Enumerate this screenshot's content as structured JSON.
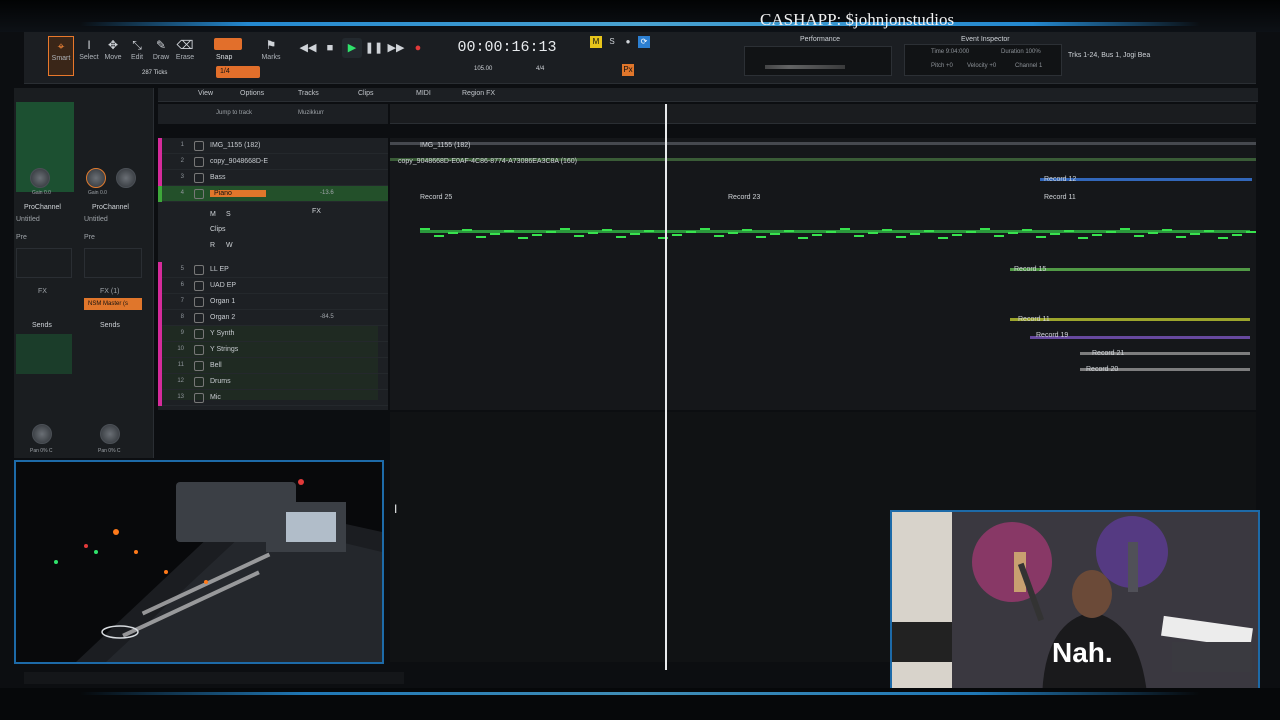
{
  "overlay": {
    "cashapp_text": "CASHAPP: $johnjonstudios"
  },
  "toolbar": {
    "tools": [
      {
        "label": "Smart",
        "icon": "smart-tool-icon",
        "active": true
      },
      {
        "label": "Select",
        "icon": "select-tool-icon",
        "active": false
      },
      {
        "label": "Move",
        "icon": "move-tool-icon",
        "active": false
      },
      {
        "label": "Edit",
        "icon": "edit-tool-icon",
        "active": false
      },
      {
        "label": "Draw",
        "icon": "draw-tool-icon",
        "active": false
      },
      {
        "label": "Erase",
        "icon": "erase-tool-icon",
        "active": false
      }
    ],
    "snap_label": "Snap",
    "snap_value": "1/4",
    "markers_label": "Marks",
    "ticks_label": "287 Ticks"
  },
  "transport": {
    "timecode": "00:00:16:13",
    "tempo": "105.00",
    "meter": "4/4",
    "beat": "4/4"
  },
  "panels": {
    "performance_title": "Performance",
    "event_inspector_title": "Event Inspector",
    "inspector_time": "Time  9:04:000",
    "inspector_duration": "Duration  100%",
    "inspector_pitch": "Pitch  +0",
    "inspector_velocity": "Velocity  +0",
    "inspector_channel": "Channel  1",
    "track_info": "Trks 1-24, Bus 1, Jogi Bea"
  },
  "inspector": {
    "left_strip": {
      "title": "ProChannel",
      "sub": "Untitled",
      "pre": "Pre",
      "fx": "FX",
      "sends": "Sends",
      "pan": "Pan 0% C",
      "gain": "Gain 0.0"
    },
    "right_strip": {
      "title": "ProChannel",
      "sub": "Untitled",
      "pre": "Pre",
      "fx": "FX (1)",
      "bus": "NSM Master (s",
      "sends": "Sends",
      "pan": "Pan 0% C",
      "gain": "Gain 0.0"
    }
  },
  "trackview": {
    "menus": [
      "View",
      "Options",
      "Tracks",
      "Clips",
      "MIDI",
      "Region FX"
    ],
    "jump_to_track": "Jump to track",
    "workspace": "Muzikkurr"
  },
  "tracks": [
    {
      "num": "1",
      "name": "IMG_1155 (182)",
      "color": "#d62b9b",
      "vol": ""
    },
    {
      "num": "2",
      "name": "copy_9048668D-E",
      "color": "#d62b9b",
      "vol": ""
    },
    {
      "num": "3",
      "name": "Bass",
      "color": "#d62b9b",
      "vol": ""
    },
    {
      "num": "4",
      "name": "Piano",
      "color": "#3ea83a",
      "vol": "-13.6"
    },
    {
      "num": "5",
      "name": "LL EP",
      "color": "#d62b9b",
      "vol": ""
    },
    {
      "num": "6",
      "name": "UAD EP",
      "color": "#d62b9b",
      "vol": ""
    },
    {
      "num": "7",
      "name": "Organ 1",
      "color": "#d62b9b",
      "vol": ""
    },
    {
      "num": "8",
      "name": "Organ 2",
      "color": "#d62b9b",
      "vol": "-84.5"
    },
    {
      "num": "9",
      "name": "Y Synth",
      "color": "#d62b9b",
      "vol": ""
    },
    {
      "num": "10",
      "name": "Y Strings",
      "color": "#d62b9b",
      "vol": ""
    },
    {
      "num": "11",
      "name": "Bell",
      "color": "#d62b9b",
      "vol": ""
    },
    {
      "num": "12",
      "name": "Drums",
      "color": "#d62b9b",
      "vol": ""
    },
    {
      "num": "13",
      "name": "Mic",
      "color": "#d62b9b",
      "vol": ""
    }
  ],
  "piano_controls": {
    "m": "M",
    "s": "S",
    "fx": "FX",
    "clips": "Clips",
    "r": "R",
    "w": "W"
  },
  "clips": {
    "row1": "IMG_1155 (182)",
    "row2": "copy_9048668D-E0AF-4C86-8774-A73086EA3C8A (160)",
    "record12": "Record 12",
    "record25": "Record 25",
    "record23": "Record 23",
    "record11": "Record 11",
    "record15": "Record 15",
    "record11b": "Record 11",
    "record19": "Record 19",
    "record21": "Record 21",
    "record20": "Record 20"
  },
  "shirt_text": "Nah."
}
